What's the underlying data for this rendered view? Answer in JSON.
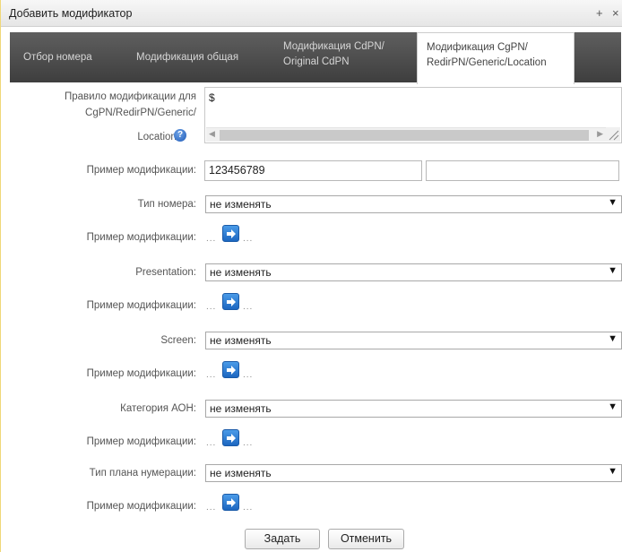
{
  "window": {
    "title": "Добавить модификатор",
    "maximize_icon": "+",
    "close_icon": "×"
  },
  "tabs": [
    {
      "line1": "Отбор номера",
      "line2": ""
    },
    {
      "line1": "Модификация общая",
      "line2": ""
    },
    {
      "line1": "Модификация CdPN/",
      "line2": "Original CdPN"
    },
    {
      "line1": "Модификация CgPN/",
      "line2": "RedirPN/Generic/Location",
      "active": true
    }
  ],
  "rule": {
    "label_line1": "Правило модификации для",
    "label_line2": "CgPN/RedirPN/Generic/",
    "label_line3": "Location:",
    "value": "$",
    "help_icon": "?"
  },
  "example1": {
    "label": "Пример модификации:",
    "input_value": "123456789",
    "output_value": ""
  },
  "fields": [
    {
      "label": "Тип номера:",
      "value": "не изменять",
      "example_label": "Пример модификации:",
      "example_left": "...",
      "example_right": "..."
    },
    {
      "label": "Presentation:",
      "value": "не изменять",
      "example_label": "Пример модификации:",
      "example_left": "...",
      "example_right": "..."
    },
    {
      "label": "Screen:",
      "value": "не изменять",
      "example_label": "Пример модификации:",
      "example_left": "...",
      "example_right": "..."
    },
    {
      "label": "Категория АОН:",
      "value": "не изменять",
      "example_label": "Пример модификации:",
      "example_left": "...",
      "example_right": "..."
    },
    {
      "label": "Тип плана нумерации:",
      "value": "не изменять",
      "example_label": "Пример модификации:",
      "example_left": "...",
      "example_right": "..."
    }
  ],
  "buttons": {
    "submit": "Задать",
    "cancel": "Отменить"
  },
  "colors": {
    "tab_bar": "#4a4a4a",
    "arrow_button": "#2a78d0",
    "dialog_border": "#f0d878"
  }
}
